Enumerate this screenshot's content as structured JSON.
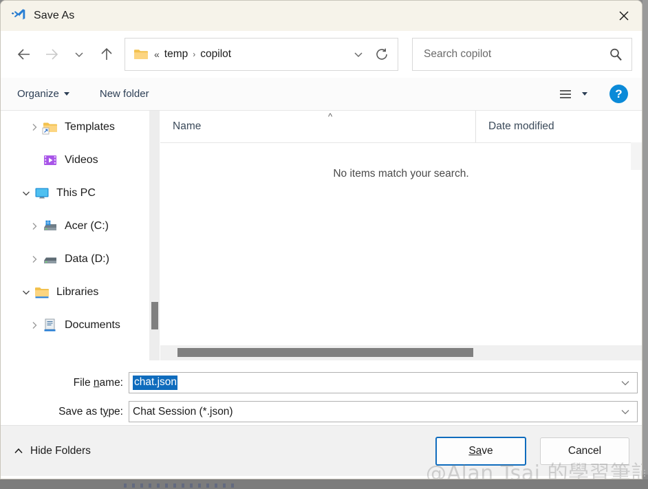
{
  "window": {
    "title": "Save As",
    "app_icon": "vscode-icon",
    "close_label": "✕",
    "titlebar_color": "#f6f3ea"
  },
  "nav": {
    "back": "back-arrow",
    "forward": "forward-arrow",
    "recent": "chevron-down",
    "up": "up-arrow"
  },
  "address": {
    "folder_icon": "folder-icon",
    "overflow": "«",
    "separator": "›",
    "crumbs": [
      "temp",
      "copilot"
    ],
    "dropdown_icon": "chevron-down-icon",
    "refresh_icon": "refresh-icon"
  },
  "search": {
    "placeholder": "Search copilot",
    "value": "",
    "icon": "search-icon"
  },
  "commandbar": {
    "organize_label": "Organize",
    "new_folder_label": "New folder",
    "view_icon": "list-view-icon",
    "view_dropdown_icon": "chevron-down-icon",
    "help_label": "?"
  },
  "sidebar": {
    "items": [
      {
        "label": "Templates",
        "icon": "folder-shortcut-icon",
        "expander": "collapsed",
        "indent": 1
      },
      {
        "label": "Videos",
        "icon": "videos-icon",
        "expander": "none",
        "indent": 1
      },
      {
        "label": "This PC",
        "icon": "this-pc-icon",
        "expander": "expanded",
        "indent": 0
      },
      {
        "label": "Acer (C:)",
        "icon": "system-drive-icon",
        "expander": "collapsed",
        "indent": 1
      },
      {
        "label": "Data (D:)",
        "icon": "drive-icon",
        "expander": "collapsed",
        "indent": 1
      },
      {
        "label": "Libraries",
        "icon": "libraries-icon",
        "expander": "expanded",
        "indent": 0
      },
      {
        "label": "Documents",
        "icon": "documents-library-icon",
        "expander": "collapsed",
        "indent": 1
      }
    ]
  },
  "filelist": {
    "columns": [
      {
        "label": "Name",
        "sort": "ascending"
      },
      {
        "label": "Date modified",
        "sort": "none"
      }
    ],
    "rows": [],
    "empty_message": "No items match your search."
  },
  "form": {
    "filename": {
      "label_prefix": "File ",
      "label_accel": "n",
      "label_suffix": "ame:",
      "value": "chat.json",
      "selected": true
    },
    "filetype": {
      "label_prefix": "Save as t",
      "label_accel": "y",
      "label_suffix": "pe:",
      "value": "Chat Session (*.json)"
    },
    "selection_color": "#0f6cbd"
  },
  "footer": {
    "hide_folders_label": "Hide Folders",
    "hide_folders_icon": "chevron-up-icon",
    "save": {
      "prefix": "S",
      "accel": "a",
      "suffix": "ve",
      "focused": true
    },
    "cancel": {
      "prefix": "",
      "accel": "C",
      "suffix": "ancel"
    }
  },
  "watermark": {
    "text": "@Alan Tsai 的學習筆記"
  }
}
